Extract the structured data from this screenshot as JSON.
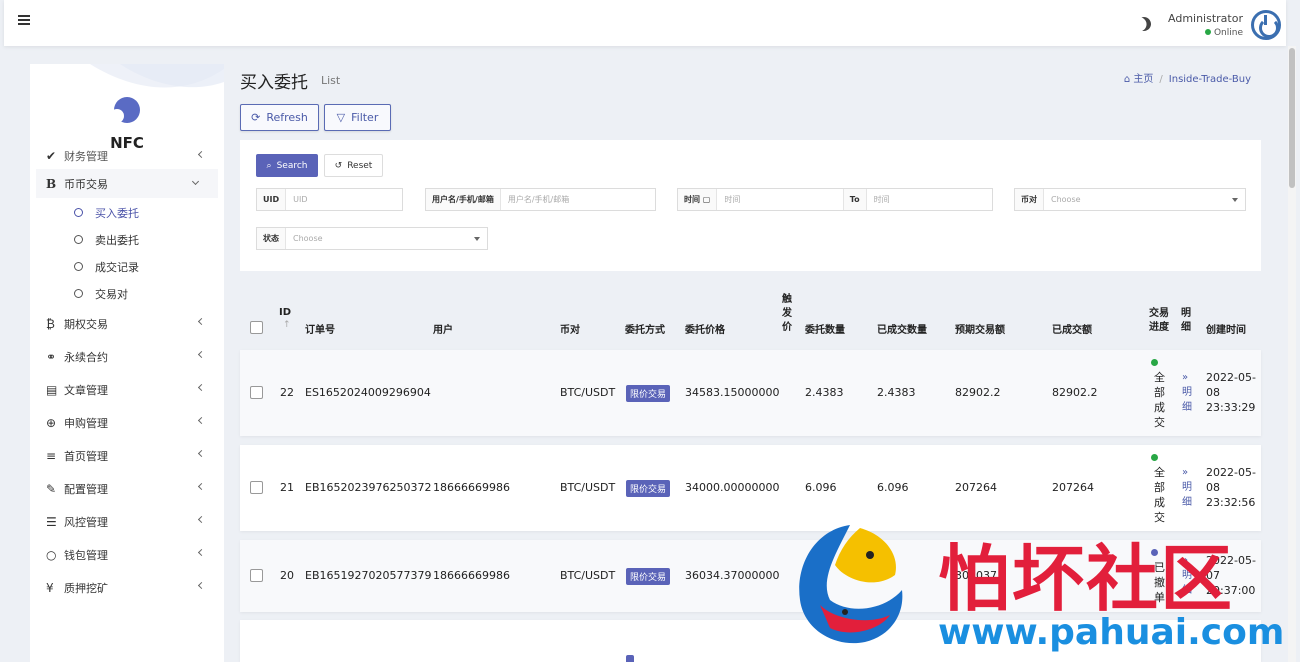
{
  "header": {
    "admin_name": "Administrator",
    "status": "Online"
  },
  "sidebar": {
    "brand": "NFC",
    "partial_item": "财务管理",
    "group_open": {
      "label": "币币交易",
      "icon": "B"
    },
    "sub_items": [
      {
        "label": "买入委托",
        "active": true
      },
      {
        "label": "卖出委托",
        "active": false
      },
      {
        "label": "成交记录",
        "active": false
      },
      {
        "label": "交易对",
        "active": false
      }
    ],
    "items": [
      {
        "label": "期权交易",
        "icon": "bitcoin-icon",
        "glyph": "₿"
      },
      {
        "label": "永续合约",
        "icon": "link-icon",
        "glyph": "⚭"
      },
      {
        "label": "文章管理",
        "icon": "newspaper-icon",
        "glyph": "▤"
      },
      {
        "label": "申购管理",
        "icon": "lifebuoy-icon",
        "glyph": "⊕"
      },
      {
        "label": "首页管理",
        "icon": "list-icon",
        "glyph": "≡"
      },
      {
        "label": "配置管理",
        "icon": "wrench-icon",
        "glyph": "✎"
      },
      {
        "label": "风控管理",
        "icon": "indent-icon",
        "glyph": "☰"
      },
      {
        "label": "钱包管理",
        "icon": "circle-icon",
        "glyph": "○"
      },
      {
        "label": "质押挖矿",
        "icon": "yen-icon",
        "glyph": "¥"
      }
    ]
  },
  "page": {
    "title": "买入委托",
    "subtitle": "List",
    "breadcrumb_home": "主页",
    "breadcrumb_current": "Inside-Trade-Buy",
    "refresh_label": "Refresh",
    "filter_label": "Filter"
  },
  "filters": {
    "search_label": "Search",
    "reset_label": "Reset",
    "uid_label": "UID",
    "uid_placeholder": "UID",
    "user_label": "用户名/手机/邮箱",
    "user_placeholder": "用户名/手机/邮箱",
    "time_label": "时间",
    "time_placeholder": "时间",
    "to_label": "To",
    "to_placeholder": "时间",
    "pair_label": "币对",
    "pair_value": "Choose",
    "state_label": "状态",
    "state_value": "Choose"
  },
  "table": {
    "headers": {
      "id": "ID",
      "order_no": "订单号",
      "user": "用户",
      "pair": "币对",
      "method": "委托方式",
      "price": "委托价格",
      "trigger": "触发价",
      "qty": "委托数量",
      "filled_qty": "已成交数量",
      "expected_amount": "预期交易额",
      "filled_amount": "已成交额",
      "progress": "交易进度",
      "detail": "明细",
      "created": "创建时间"
    },
    "rows": [
      {
        "id": "22",
        "order_no": "ES1652024009296904",
        "user": "",
        "pair": "BTC/USDT",
        "method": "限价交易",
        "price": "34583.15000000",
        "qty": "2.4383",
        "filled_qty": "2.4383",
        "expected": "82902.2",
        "filled_amount": "82902.2",
        "progress": "全部成交",
        "detail": "» 明细",
        "created": "2022-05-08 23:33:29"
      },
      {
        "id": "21",
        "order_no": "EB1652023976250372",
        "user": "18666669986",
        "pair": "BTC/USDT",
        "method": "限价交易",
        "price": "34000.00000000",
        "qty": "6.096",
        "filled_qty": "6.096",
        "expected": "207264",
        "filled_amount": "207264",
        "progress": "全部成交",
        "detail": "» 明细",
        "created": "2022-05-08 23:32:56"
      },
      {
        "id": "20",
        "order_no": "EB1651927020577379",
        "user": "18666669986",
        "pair": "BTC/USDT",
        "method": "限价交易",
        "price": "36034.37000000",
        "qty": "",
        "filled_qty": "0",
        "expected": "303037",
        "filled_amount": "",
        "progress": "已撤单",
        "detail": "» 明细",
        "created": "2022-05-07 20:37:00"
      }
    ]
  },
  "watermark": {
    "cn": "怕坏社区",
    "url": "www.pahuai.com"
  }
}
